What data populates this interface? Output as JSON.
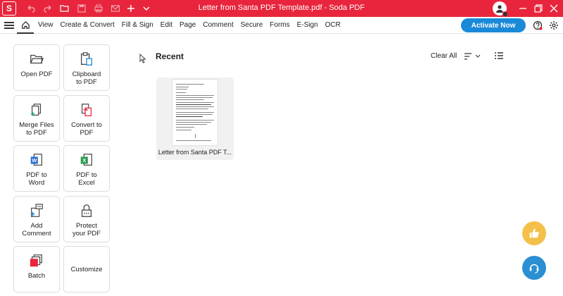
{
  "window": {
    "title": "Letter from Santa PDF Template.pdf  -  Soda PDF",
    "logo_letter": "S"
  },
  "menu": {
    "items": [
      "View",
      "Create & Convert",
      "Fill & Sign",
      "Edit",
      "Page",
      "Comment",
      "Secure",
      "Forms",
      "E-Sign",
      "OCR"
    ],
    "activate_label": "Activate Now"
  },
  "tools": [
    {
      "label": "Open PDF",
      "icon": "folder-open-icon"
    },
    {
      "label": "Clipboard\nto PDF",
      "icon": "clipboard-icon"
    },
    {
      "label": "Merge Files\nto PDF",
      "icon": "merge-files-icon"
    },
    {
      "label": "Convert to\nPDF",
      "icon": "convert-pdf-icon"
    },
    {
      "label": "PDF to\nWord",
      "icon": "word-icon"
    },
    {
      "label": "PDF to\nExcel",
      "icon": "excel-icon"
    },
    {
      "label": "Add\nComment",
      "icon": "comment-icon"
    },
    {
      "label": "Protect\nyour PDF",
      "icon": "lock-icon"
    },
    {
      "label": "Batch",
      "icon": "batch-icon"
    },
    {
      "label": "Customize",
      "icon": ""
    }
  ],
  "recent": {
    "title": "Recent",
    "clear_all": "Clear All",
    "files": [
      {
        "name": "Letter from Santa PDF T..."
      }
    ]
  },
  "colors": {
    "brand": "#e8253c",
    "accent": "#1a8ad8",
    "like": "#f5c04a",
    "help": "#2b8fd4"
  }
}
